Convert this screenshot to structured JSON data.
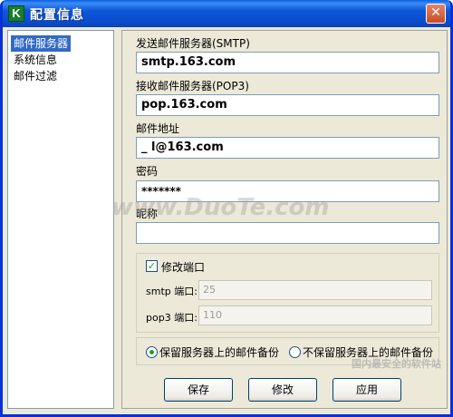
{
  "window": {
    "title": "配置信息",
    "app_icon_glyph": "K",
    "close_glyph": "✕"
  },
  "sidebar": {
    "items": [
      {
        "label": "邮件服务器",
        "selected": true
      },
      {
        "label": "系统信息",
        "selected": false
      },
      {
        "label": "邮件过滤",
        "selected": false
      }
    ]
  },
  "form": {
    "smtp_label": "发送邮件服务器(SMTP)",
    "smtp_value": "smtp.163.com",
    "pop3_label": "接收邮件服务器(POP3)",
    "pop3_value": "pop.163.com",
    "email_label": "邮件地址",
    "email_value": "_      l@163.com",
    "password_label": "密码",
    "password_value": "*******",
    "nickname_label": "昵称",
    "nickname_value": ""
  },
  "ports": {
    "modify_label": "修改端口",
    "modify_checked": true,
    "smtp_port_label": "smtp 端口:",
    "smtp_port_value": "25",
    "pop3_port_label": "pop3 端口:",
    "pop3_port_value": "110"
  },
  "backup": {
    "keep_label": "保留服务器上的邮件备份",
    "keep_selected": true,
    "nokeep_label": "不保留服务器上的邮件备份"
  },
  "buttons": {
    "save": "保存",
    "modify": "修改",
    "apply": "应用"
  },
  "watermark": {
    "main": "www.DuoTe.com",
    "corner": "国内最安全的软件站"
  },
  "colors": {
    "title_bar": "#0a4ccc",
    "selection": "#316ac5",
    "check": "#21a121",
    "window_bg": "#ece9d8"
  }
}
